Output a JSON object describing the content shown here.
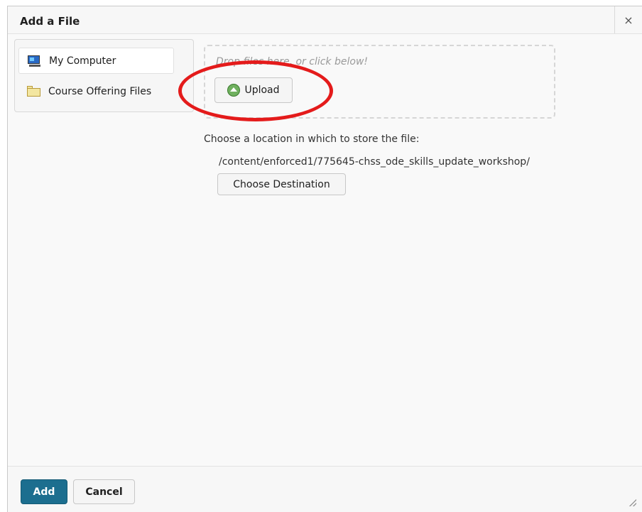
{
  "dialog": {
    "title": "Add a File",
    "close_symbol": "×"
  },
  "sidebar": {
    "items": [
      {
        "label": "My Computer",
        "icon": "computer-icon",
        "selected": true
      },
      {
        "label": "Course Offering Files",
        "icon": "folder-icon",
        "selected": false
      }
    ]
  },
  "upload_area": {
    "drop_hint": "Drop files here, or click below!",
    "upload_label": "Upload",
    "upload_icon": "upload-arrow-icon"
  },
  "destination": {
    "prompt": "Choose a location in which to store the file:",
    "path": "/content/enforced1/775645-chss_ode_skills_update_workshop/",
    "choose_label": "Choose Destination"
  },
  "footer": {
    "add_label": "Add",
    "cancel_label": "Cancel"
  },
  "colors": {
    "primary_button": "#1c6e8f",
    "highlight_annotation": "#e41b1b"
  }
}
